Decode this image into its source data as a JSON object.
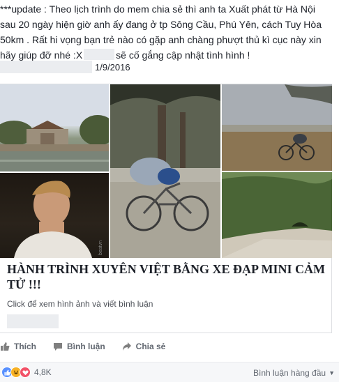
{
  "post": {
    "lines": [
      "***update : Theo lịch trình do mem chia sẻ thì anh ta Xuất phát từ Hà Nội",
      "sau 20 ngày hiện giờ anh ấy đang ở tp Sông Cầu, Phú Yên, cách Tuy Hòa",
      "50km . Rất hi vọng bạn trẻ nào có gặp anh chàng phượt thủ kì cục này xin"
    ],
    "last_line_before": "hãy giúp đỡ nhé :X",
    "last_line_after": "sẽ cố gắng cập nhật tình hình !",
    "date": "1/9/2016"
  },
  "link_card": {
    "title": "HÀNH TRÌNH XUYÊN VIỆT BẰNG XE ĐẠP MINI CẢM TỬ !!!",
    "subtitle": "Click để xem hình ảnh và viết bình luận",
    "photo_watermark": "beatvn"
  },
  "actions": {
    "like": "Thích",
    "comment": "Bình luận",
    "share": "Chia sẻ"
  },
  "reactions": {
    "icons": [
      "like-icon",
      "haha-icon",
      "love-icon"
    ],
    "count": "4,8K",
    "sort_label": "Bình luận hàng đầu"
  },
  "colors": {
    "like": "#5890ff",
    "haha": "#f7b125",
    "love": "#f25268"
  }
}
